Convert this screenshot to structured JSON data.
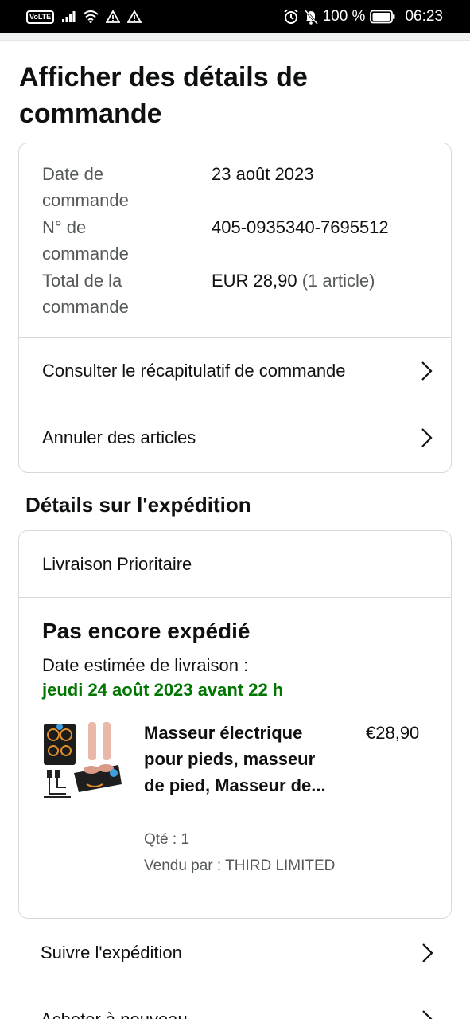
{
  "status_bar": {
    "volte": "VoLTE",
    "battery": "100 %",
    "time": "06:23"
  },
  "page": {
    "title": "Afficher des détails de commande"
  },
  "order_info": {
    "rows": [
      {
        "label": "Date de commande",
        "value": "23 août 2023"
      },
      {
        "label": "N° de commande",
        "value": "405-0935340-7695512"
      },
      {
        "label": "Total de la commande",
        "value": "EUR 28,90",
        "extra": "(1 article)"
      }
    ],
    "links": [
      {
        "label": "Consulter le récapitulatif de commande"
      },
      {
        "label": "Annuler des articles"
      }
    ]
  },
  "shipment": {
    "section_title": "Détails sur l'expédition",
    "method": "Livraison Prioritaire",
    "status": "Pas encore expédié",
    "estimate_label": "Date estimée de livraison :",
    "estimate_date": "jeudi 24 août 2023 avant 22 h",
    "colors": {
      "estimate": "#007600"
    },
    "item": {
      "title": "Masseur électrique pour pieds, masseur de pied, Masseur de...",
      "price": "€28,90",
      "qty": "Qté : 1",
      "seller": "Vendu par : THIRD LIMITED"
    }
  },
  "actions": [
    {
      "label": "Suivre l'expédition"
    },
    {
      "label": "Acheter à nouveau"
    }
  ],
  "icons": {
    "chevron": "chevron-right-icon"
  }
}
